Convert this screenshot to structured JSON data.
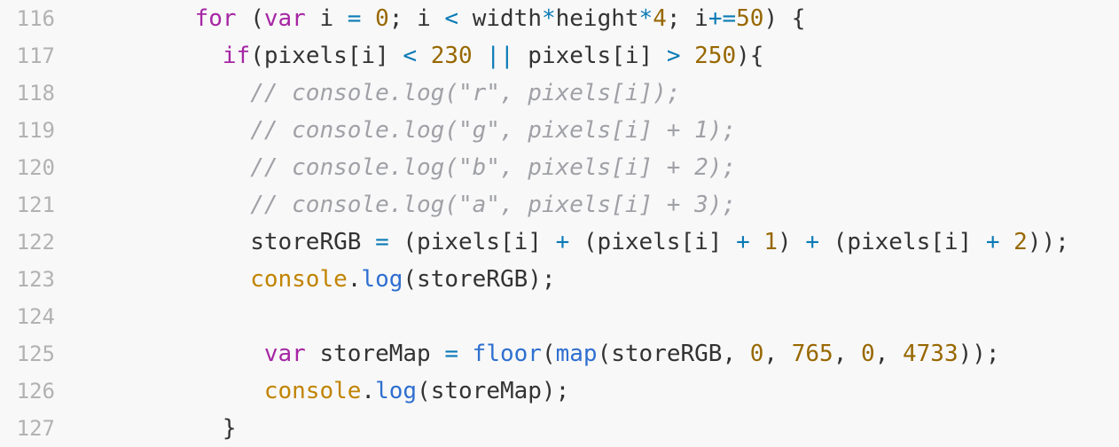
{
  "editor": {
    "lines": [
      {
        "num": "116",
        "indent": "       ",
        "tokens": [
          {
            "t": "for",
            "c": "kw"
          },
          {
            "t": " ("
          },
          {
            "t": "var",
            "c": "kw"
          },
          {
            "t": " i "
          },
          {
            "t": "=",
            "c": "op"
          },
          {
            "t": " "
          },
          {
            "t": "0",
            "c": "num"
          },
          {
            "t": "; i "
          },
          {
            "t": "<",
            "c": "op"
          },
          {
            "t": " width"
          },
          {
            "t": "*",
            "c": "op"
          },
          {
            "t": "height"
          },
          {
            "t": "*",
            "c": "op"
          },
          {
            "t": "4",
            "c": "num"
          },
          {
            "t": "; i"
          },
          {
            "t": "+=",
            "c": "op"
          },
          {
            "t": "50",
            "c": "num"
          },
          {
            "t": ") {"
          }
        ]
      },
      {
        "num": "117",
        "indent": "         ",
        "tokens": [
          {
            "t": "if",
            "c": "kw"
          },
          {
            "t": "(pixels[i] "
          },
          {
            "t": "<",
            "c": "op"
          },
          {
            "t": " "
          },
          {
            "t": "230",
            "c": "num"
          },
          {
            "t": " "
          },
          {
            "t": "||",
            "c": "op"
          },
          {
            "t": " pixels[i] "
          },
          {
            "t": ">",
            "c": "op"
          },
          {
            "t": " "
          },
          {
            "t": "250",
            "c": "num"
          },
          {
            "t": "){"
          }
        ]
      },
      {
        "num": "118",
        "indent": "           ",
        "tokens": [
          {
            "t": "// console.log(\"r\", pixels[i]);",
            "c": "cm"
          }
        ]
      },
      {
        "num": "119",
        "indent": "           ",
        "tokens": [
          {
            "t": "// console.log(\"g\", pixels[i] + 1);",
            "c": "cm"
          }
        ]
      },
      {
        "num": "120",
        "indent": "           ",
        "tokens": [
          {
            "t": "// console.log(\"b\", pixels[i] + 2);",
            "c": "cm"
          }
        ]
      },
      {
        "num": "121",
        "indent": "           ",
        "tokens": [
          {
            "t": "// console.log(\"a\", pixels[i] + 3);",
            "c": "cm"
          }
        ]
      },
      {
        "num": "122",
        "indent": "           ",
        "tokens": [
          {
            "t": "storeRGB "
          },
          {
            "t": "=",
            "c": "op"
          },
          {
            "t": " (pixels[i] "
          },
          {
            "t": "+",
            "c": "op"
          },
          {
            "t": " (pixels[i] "
          },
          {
            "t": "+",
            "c": "op"
          },
          {
            "t": " "
          },
          {
            "t": "1",
            "c": "num"
          },
          {
            "t": ") "
          },
          {
            "t": "+",
            "c": "op"
          },
          {
            "t": " (pixels[i] "
          },
          {
            "t": "+",
            "c": "op"
          },
          {
            "t": " "
          },
          {
            "t": "2",
            "c": "num"
          },
          {
            "t": "));"
          }
        ]
      },
      {
        "num": "123",
        "indent": "           ",
        "tokens": [
          {
            "t": "console",
            "c": "obj"
          },
          {
            "t": "."
          },
          {
            "t": "log",
            "c": "fn"
          },
          {
            "t": "(storeRGB);"
          }
        ]
      },
      {
        "num": "124",
        "indent": "",
        "tokens": []
      },
      {
        "num": "125",
        "indent": "            ",
        "tokens": [
          {
            "t": "var",
            "c": "kw"
          },
          {
            "t": " storeMap "
          },
          {
            "t": "=",
            "c": "op"
          },
          {
            "t": " "
          },
          {
            "t": "floor",
            "c": "fn"
          },
          {
            "t": "("
          },
          {
            "t": "map",
            "c": "fn"
          },
          {
            "t": "(storeRGB, "
          },
          {
            "t": "0",
            "c": "num"
          },
          {
            "t": ", "
          },
          {
            "t": "765",
            "c": "num"
          },
          {
            "t": ", "
          },
          {
            "t": "0",
            "c": "num"
          },
          {
            "t": ", "
          },
          {
            "t": "4733",
            "c": "num"
          },
          {
            "t": "));"
          }
        ]
      },
      {
        "num": "126",
        "indent": "            ",
        "tokens": [
          {
            "t": "console",
            "c": "obj"
          },
          {
            "t": "."
          },
          {
            "t": "log",
            "c": "fn"
          },
          {
            "t": "(storeMap);"
          }
        ]
      },
      {
        "num": "127",
        "indent": "         ",
        "tokens": [
          {
            "t": "}"
          }
        ]
      }
    ]
  }
}
